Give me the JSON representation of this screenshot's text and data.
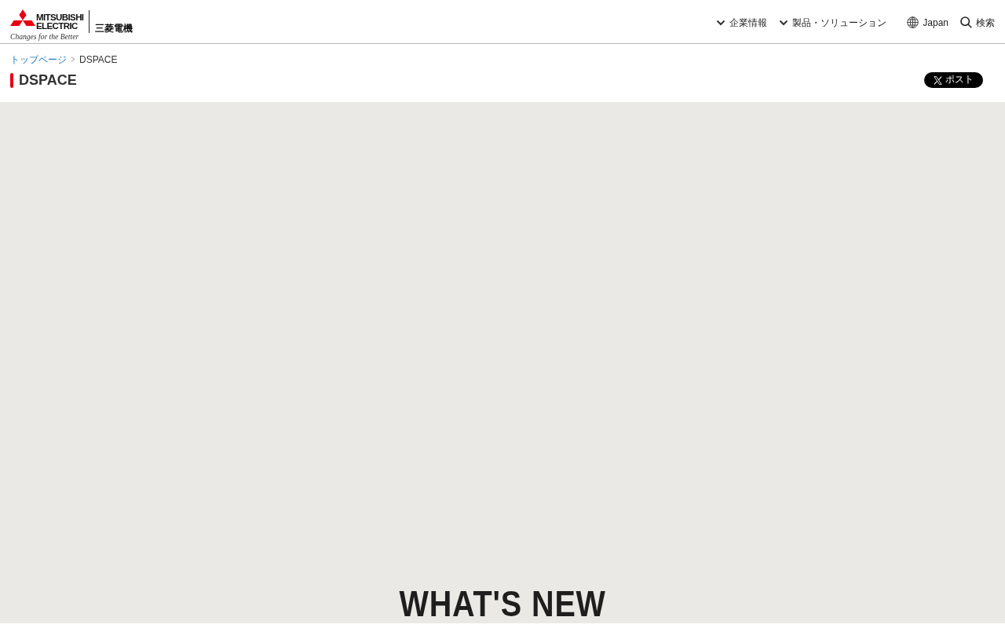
{
  "header": {
    "logo": {
      "brand_lines": [
        "MITSUBISHI",
        "ELECTRIC"
      ],
      "tagline": "Changes for the Better",
      "japanese_name": "三菱電機"
    },
    "nav": [
      {
        "label": "企業情報",
        "kind": "dropdown"
      },
      {
        "label": "製品・ソリューション",
        "kind": "dropdown"
      },
      {
        "label": "Japan",
        "kind": "region"
      },
      {
        "label": "検索",
        "kind": "search"
      }
    ]
  },
  "breadcrumb": [
    {
      "label": "トップページ",
      "kind": "link"
    },
    {
      "label": "DSPACE",
      "kind": "current"
    }
  ],
  "page_title": "DSPACE",
  "share_button": {
    "label": "ポスト"
  },
  "main": {
    "heading": "WHAT'S NEW"
  }
}
